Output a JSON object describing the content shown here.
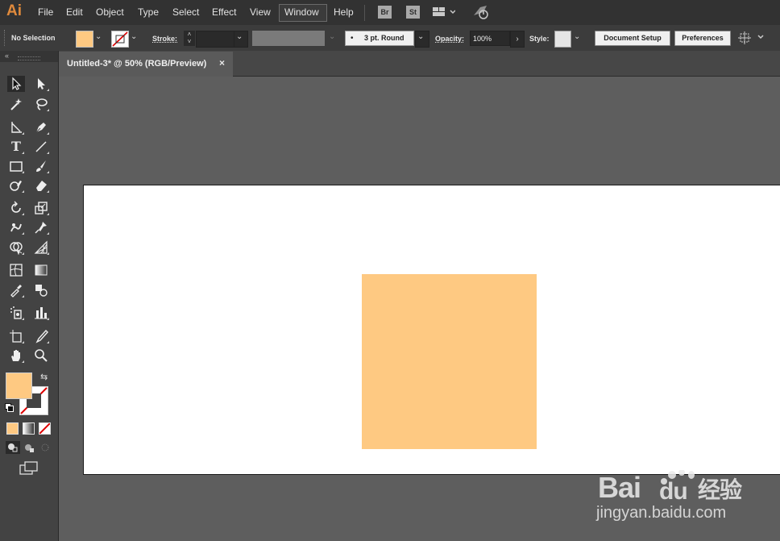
{
  "app": {
    "logo": "Ai"
  },
  "menu": {
    "items": [
      "File",
      "Edit",
      "Object",
      "Type",
      "Select",
      "Effect",
      "View",
      "Window",
      "Help"
    ],
    "bridge": "Br",
    "stock": "St"
  },
  "control": {
    "selection_status": "No Selection",
    "stroke_label": "Stroke:",
    "brush_preset": "3 pt. Round",
    "opacity_label": "Opacity:",
    "opacity_value": "100%",
    "style_label": "Style:",
    "document_setup": "Document Setup",
    "preferences": "Preferences",
    "fill_color": "#fec982"
  },
  "document": {
    "tab_title": "Untitled-3* @ 50% (RGB/Preview)",
    "close_glyph": "×",
    "rectangle_color": "#fec982"
  },
  "watermark": {
    "logo": "Bai du 经验",
    "url": "jingyan.baidu.com"
  }
}
